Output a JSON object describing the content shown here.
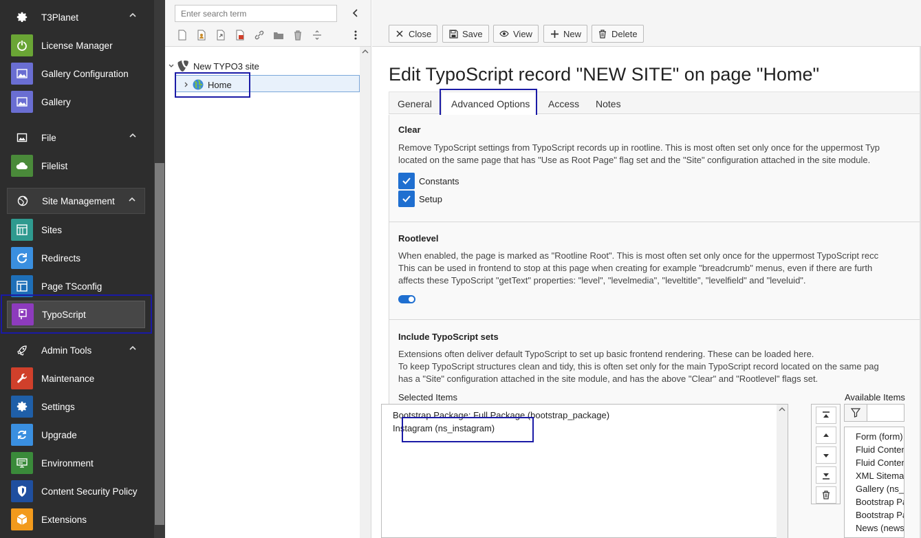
{
  "module_menu": {
    "groups": {
      "t3planet": {
        "label": "T3Planet"
      },
      "file": {
        "label": "File"
      },
      "site_management": {
        "label": "Site Management"
      },
      "admin_tools": {
        "label": "Admin Tools"
      }
    },
    "items": {
      "license_manager": {
        "label": "License Manager",
        "color": "#6aa535"
      },
      "gallery_configuration": {
        "label": "Gallery Configuration",
        "color": "#6a6ed2"
      },
      "gallery": {
        "label": "Gallery",
        "color": "#6a6ed2"
      },
      "filelist": {
        "label": "Filelist",
        "color": "#4a8a3a"
      },
      "sites": {
        "label": "Sites",
        "color": "#2f9a8f"
      },
      "redirects": {
        "label": "Redirects",
        "color": "#3a8fe0"
      },
      "page_tsconfig": {
        "label": "Page TSconfig",
        "color": "#1e6fb8"
      },
      "typoscript": {
        "label": "TypoScript",
        "color": "#8d3bbd"
      },
      "maintenance": {
        "label": "Maintenance",
        "color": "#d0402b"
      },
      "settings": {
        "label": "Settings",
        "color": "#1f5fa8"
      },
      "upgrade": {
        "label": "Upgrade",
        "color": "#3a8fe0"
      },
      "environment": {
        "label": "Environment",
        "color": "#3a8a3a"
      },
      "content_security_policy": {
        "label": "Content Security Policy",
        "color": "#1f4f9f"
      },
      "extensions": {
        "label": "Extensions",
        "color": "#f29a1c"
      }
    }
  },
  "page_tree": {
    "search_placeholder": "Enter search term",
    "root_label": "New TYPO3 site",
    "home_label": "Home"
  },
  "doc_header": {
    "buttons": {
      "close": "Close",
      "save": "Save",
      "view": "View",
      "new": "New",
      "delete": "Delete"
    }
  },
  "editor": {
    "title": "Edit TypoScript record \"NEW SITE\" on page \"Home\"",
    "tabs": [
      "General",
      "Advanced Options",
      "Access",
      "Notes"
    ],
    "active_tab": "Advanced Options",
    "clear": {
      "label": "Clear",
      "desc_1": "Remove TypoScript settings from TypoScript records up in rootline. This is most often set only once for the uppermost Typ",
      "desc_2": "located on the same page that has \"Use as Root Page\" flag set and the \"Site\" configuration attached in the site module.",
      "options": [
        "Constants",
        "Setup"
      ]
    },
    "rootlevel": {
      "label": "Rootlevel",
      "desc_1": "When enabled, the page is marked as \"Rootline Root\". This is most often set only once for the uppermost TypoScript recc",
      "desc_2": "This can be used in frontend to stop at this page when creating for example \"breadcrumb\" menus, even if there are furth",
      "desc_3": "affects these TypoScript \"getText\" properties: \"level\", \"levelmedia\", \"leveltitle\", \"levelfield\" and \"leveluid\".",
      "enabled": true
    },
    "include": {
      "label": "Include TypoScript sets",
      "desc_1": "Extensions often deliver default TypoScript to set up basic frontend rendering. These can be loaded here.",
      "desc_2": "To keep TypoScript structures clean and tidy, this is often set only for the main TypoScript record located on the same pag",
      "desc_3": "has a \"Site\" configuration attached in the site module, and has the above \"Clear\" and \"Rootlevel\" flags set.",
      "selected_label": "Selected Items",
      "available_label": "Available Items",
      "selected": [
        "Bootstrap Package: Full Package (bootstrap_package)",
        "Instagram (ns_instagram)"
      ],
      "available": [
        "Form (form)",
        "Fluid Content E",
        "Fluid Content E",
        "XML Sitemap (s",
        "Gallery (ns_gal",
        "Bootstrap Pack",
        "Bootstrap Pack",
        "News (news)"
      ]
    }
  }
}
